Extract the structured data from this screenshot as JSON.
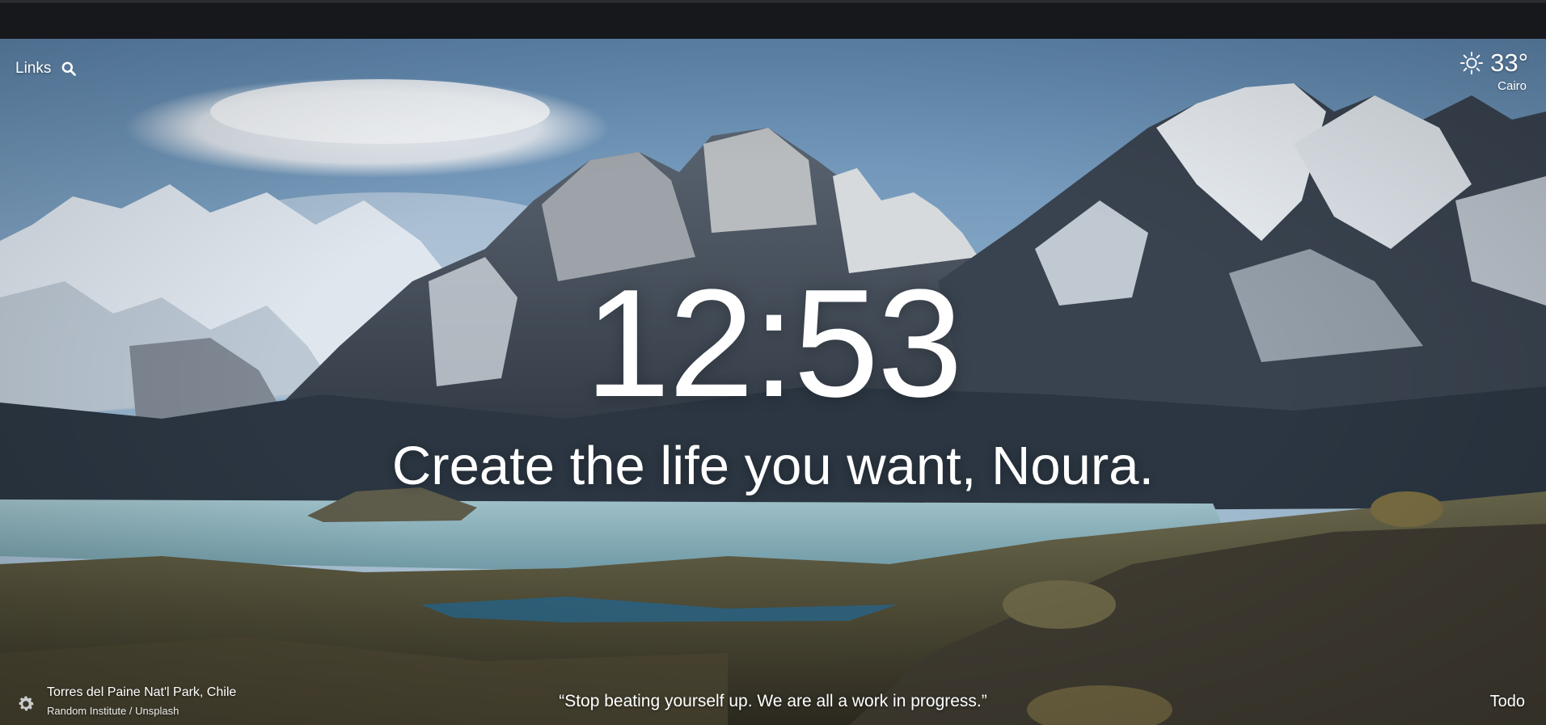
{
  "links": {
    "label": "Links",
    "search_icon": "search-icon"
  },
  "weather": {
    "icon": "sun-icon",
    "temperature": "33°",
    "city": "Cairo"
  },
  "clock": {
    "time": "12:53"
  },
  "greeting": {
    "text": "Create the life you want, Noura."
  },
  "photo": {
    "location": "Torres del Paine Nat'l Park, Chile",
    "credit": "Random Institute / Unsplash",
    "settings_icon": "gear-icon"
  },
  "quote": {
    "text": "“Stop beating yourself up. We are all a work in progress.”"
  },
  "todo": {
    "label": "Todo"
  }
}
